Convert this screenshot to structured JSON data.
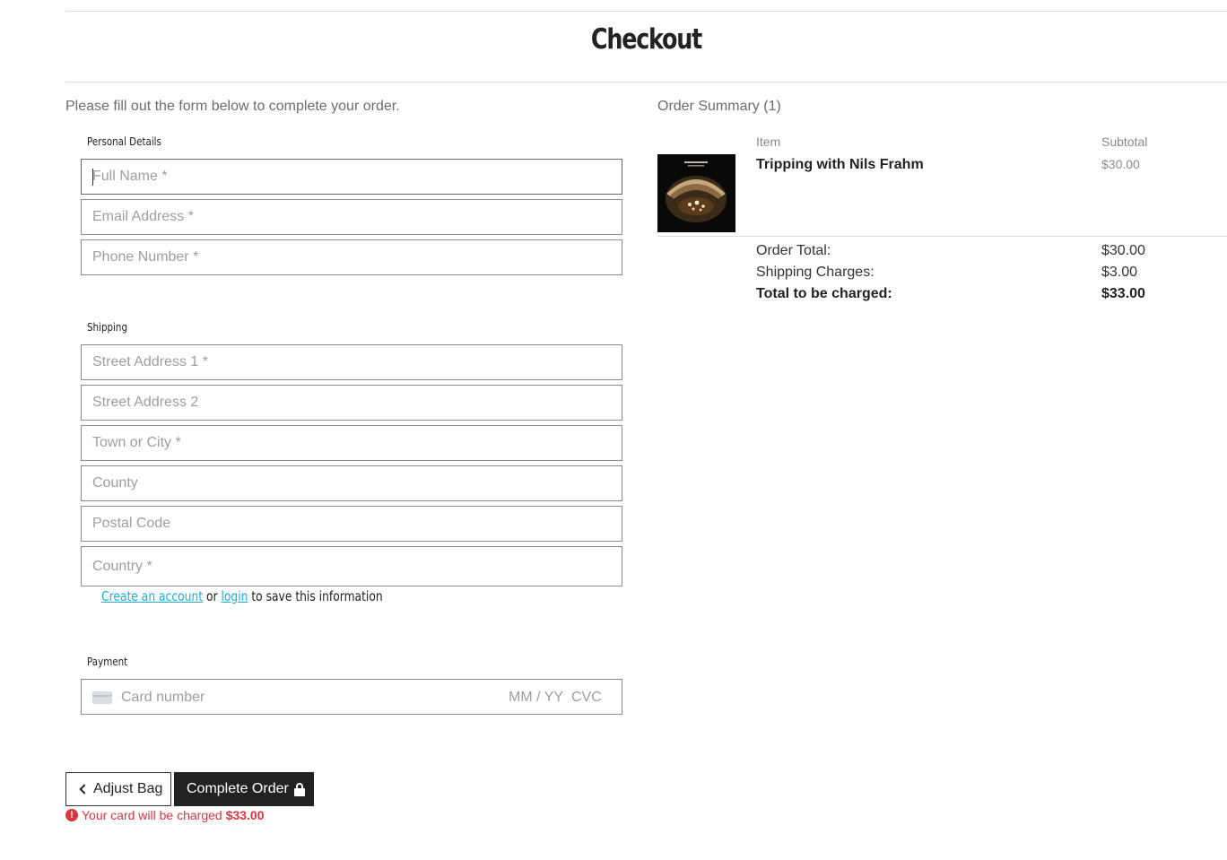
{
  "page": {
    "title": "Checkout",
    "intro": "Please fill out the form below to complete your order."
  },
  "personal": {
    "label": "Personal Details",
    "full_name_placeholder": "Full Name *",
    "email_placeholder": "Email Address *",
    "phone_placeholder": "Phone Number *"
  },
  "shipping": {
    "label": "Shipping",
    "street1_placeholder": "Street Address 1 *",
    "street2_placeholder": "Street Address 2",
    "town_placeholder": "Town or City *",
    "county_placeholder": "County",
    "postal_placeholder": "Postal Code",
    "country_placeholder": "Country *"
  },
  "account": {
    "create_link": "Create an account",
    "or_text": "or",
    "login_link": "login",
    "suffix": "to save this information"
  },
  "payment": {
    "label": "Payment",
    "card_number_placeholder": "Card number",
    "expiry_placeholder": "MM / YY",
    "cvc_placeholder": "CVC"
  },
  "buttons": {
    "adjust_bag": "Adjust Bag",
    "complete_order": "Complete Order"
  },
  "charge_note": {
    "text": "Your card will be charged",
    "amount": "$33.00"
  },
  "summary": {
    "title": "Order Summary (1)",
    "col_item": "Item",
    "col_subtotal": "Subtotal",
    "items": [
      {
        "name": "Tripping with Nils Frahm",
        "price": "$30.00"
      }
    ],
    "order_total_label": "Order Total:",
    "order_total": "$30.00",
    "shipping_label": "Shipping Charges:",
    "shipping": "$3.00",
    "grand_total_label": "Total to be charged:",
    "grand_total": "$33.00"
  },
  "colors": {
    "accent_link": "#1ab0d6",
    "error": "#d9363e",
    "button_dark": "#222222"
  }
}
